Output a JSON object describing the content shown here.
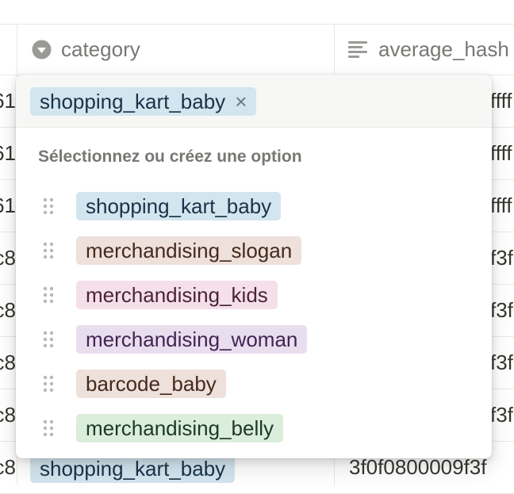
{
  "header": {
    "category": "category",
    "average_hash": "average_hash"
  },
  "rows": [
    {
      "left": "61",
      "right": "ffff"
    },
    {
      "left": "61",
      "right": "ffff"
    },
    {
      "left": "61",
      "right": "ffff"
    },
    {
      "left": "c8",
      "right": "f3f"
    },
    {
      "left": "c8",
      "right": "f3f"
    },
    {
      "left": "c8",
      "right": "f3f"
    },
    {
      "left": "c8",
      "right": "f3f"
    },
    {
      "left": "c8",
      "category_tag": "shopping_kart_baby",
      "right": "3f0f0800009f3f"
    }
  ],
  "dropdown": {
    "selected": "shopping_kart_baby",
    "remove_glyph": "×",
    "hint": "Sélectionnez ou créez une option",
    "options": [
      {
        "label": "shopping_kart_baby",
        "bg": "#d3e5ef",
        "fg": "#183347"
      },
      {
        "label": "merchandising_slogan",
        "bg": "#eee0da",
        "fg": "#442a1e"
      },
      {
        "label": "merchandising_kids",
        "bg": "#f5e0e9",
        "fg": "#4c2337"
      },
      {
        "label": "merchandising_woman",
        "bg": "#e8deee",
        "fg": "#412454"
      },
      {
        "label": "barcode_baby",
        "bg": "#eee0da",
        "fg": "#442a1e"
      },
      {
        "label": "merchandising_belly",
        "bg": "#dbeddb",
        "fg": "#1c3829"
      }
    ]
  },
  "icons": {
    "category_header": "select-property-icon",
    "average_hash_header": "text-property-icon",
    "option_handle": "drag-handle-icon"
  }
}
